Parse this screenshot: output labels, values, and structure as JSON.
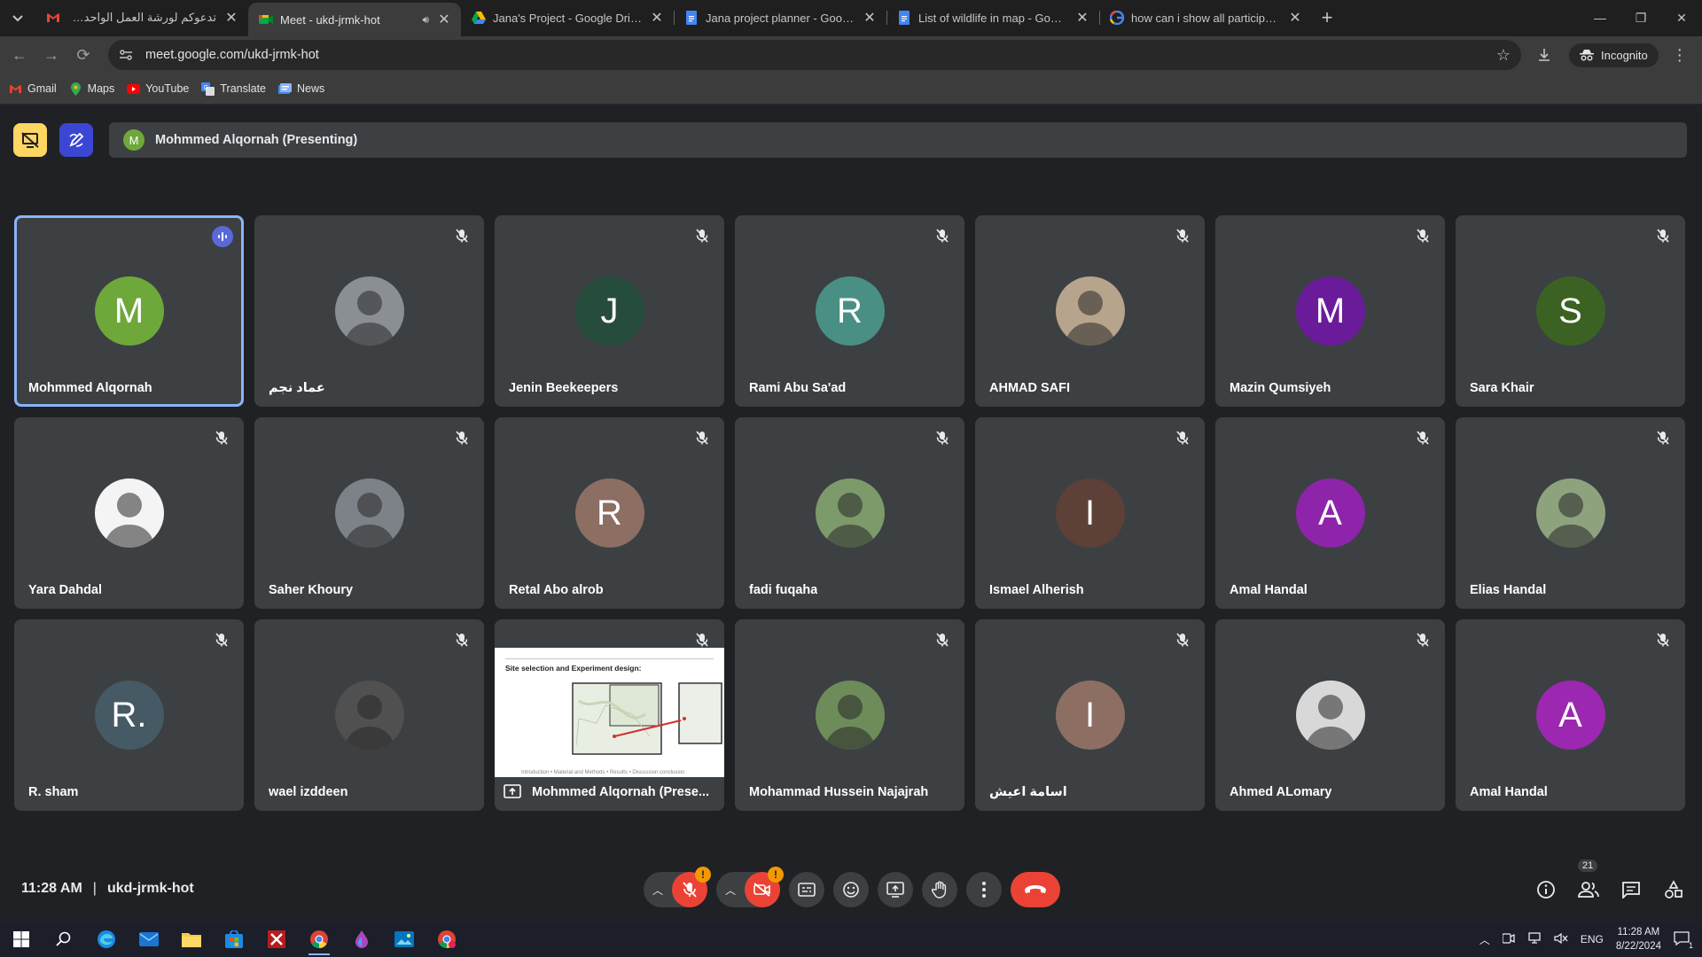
{
  "browser": {
    "tabs": [
      {
        "title": "تدعوكم لورشة العمل الواحدة وحد",
        "favicon": "gmail-icon",
        "active": false
      },
      {
        "title": "Meet - ukd-jrmk-hot",
        "favicon": "meet-icon",
        "active": true
      },
      {
        "title": "Jana's Project - Google Drive",
        "favicon": "drive-icon",
        "active": false
      },
      {
        "title": "Jana project planner - Google D",
        "favicon": "docs-icon",
        "active": false
      },
      {
        "title": "List of wildlife in map - Google",
        "favicon": "docs-icon",
        "active": false
      },
      {
        "title": "how can i show all participants",
        "favicon": "google-icon",
        "active": false
      }
    ],
    "url": "meet.google.com/ukd-jrmk-hot",
    "incognito_label": "Incognito",
    "bookmarks": [
      {
        "label": "Gmail",
        "icon": "gmail-icon"
      },
      {
        "label": "Maps",
        "icon": "maps-icon"
      },
      {
        "label": "YouTube",
        "icon": "youtube-icon"
      },
      {
        "label": "Translate",
        "icon": "translate-icon"
      },
      {
        "label": "News",
        "icon": "news-icon"
      }
    ]
  },
  "meet": {
    "presenting_initial": "M",
    "presenting_label": "Mohmmed Alqornah (Presenting)",
    "participants": [
      {
        "name": "Mohmmed Alqornah",
        "initial": "M",
        "color": "#6fa83a",
        "speaking": true
      },
      {
        "name": "عماد نجم",
        "initial": "",
        "color": "#8a8f94",
        "photo": true
      },
      {
        "name": "Jenin Beekeepers",
        "initial": "J",
        "color": "#264d3b"
      },
      {
        "name": "Rami Abu Sa'ad",
        "initial": "R",
        "color": "#4a8f84"
      },
      {
        "name": "AHMAD SAFI",
        "initial": "",
        "color": "#b7a48c",
        "photo": true
      },
      {
        "name": "Mazin Qumsiyeh",
        "initial": "M",
        "color": "#6a1b9a"
      },
      {
        "name": "Sara Khair",
        "initial": "S",
        "color": "#3b6222"
      },
      {
        "name": "Yara Dahdal",
        "initial": "",
        "color": "#f4f4f4",
        "photo": true
      },
      {
        "name": "Saher Khoury",
        "initial": "",
        "color": "#7d8288",
        "photo": true
      },
      {
        "name": "Retal Abo alrob",
        "initial": "R",
        "color": "#8d6e63"
      },
      {
        "name": "fadi fuqaha",
        "initial": "",
        "color": "#7d9a6a",
        "photo": true
      },
      {
        "name": "Ismael Alherish",
        "initial": "I",
        "color": "#5d4037"
      },
      {
        "name": "Amal Handal",
        "initial": "A",
        "color": "#8e24aa"
      },
      {
        "name": "Elias Handal",
        "initial": "",
        "color": "#8fa27e",
        "photo": true
      },
      {
        "name": "R. sham",
        "initial": "R.",
        "color": "#455a64"
      },
      {
        "name": "wael izddeen",
        "initial": "",
        "color": "#505050",
        "photo": true
      },
      {
        "name": "Mohmmed Alqornah (Prese...",
        "presentation": true
      },
      {
        "name": "Mohammad Hussein Najajrah",
        "initial": "",
        "color": "#6d8c5a",
        "photo": true
      },
      {
        "name": "اسامة اعيش",
        "initial": "I",
        "color": "#8d6e63"
      },
      {
        "name": "Ahmed ALomary",
        "initial": "",
        "color": "#d8d8d8",
        "photo": true
      },
      {
        "name": "Amal Handal",
        "initial": "A",
        "color": "#9c27b0"
      }
    ],
    "slide": {
      "title": "Site selection and Experiment design:",
      "footer": "Introduction • Material and Methods • Results • Discussion  conclusion"
    },
    "time": "11:28 AM",
    "meeting_code": "ukd-jrmk-hot",
    "participant_count": "21"
  },
  "taskbar": {
    "lang": "ENG",
    "time": "11:28 AM",
    "date": "8/22/2024",
    "notifications": "1"
  }
}
